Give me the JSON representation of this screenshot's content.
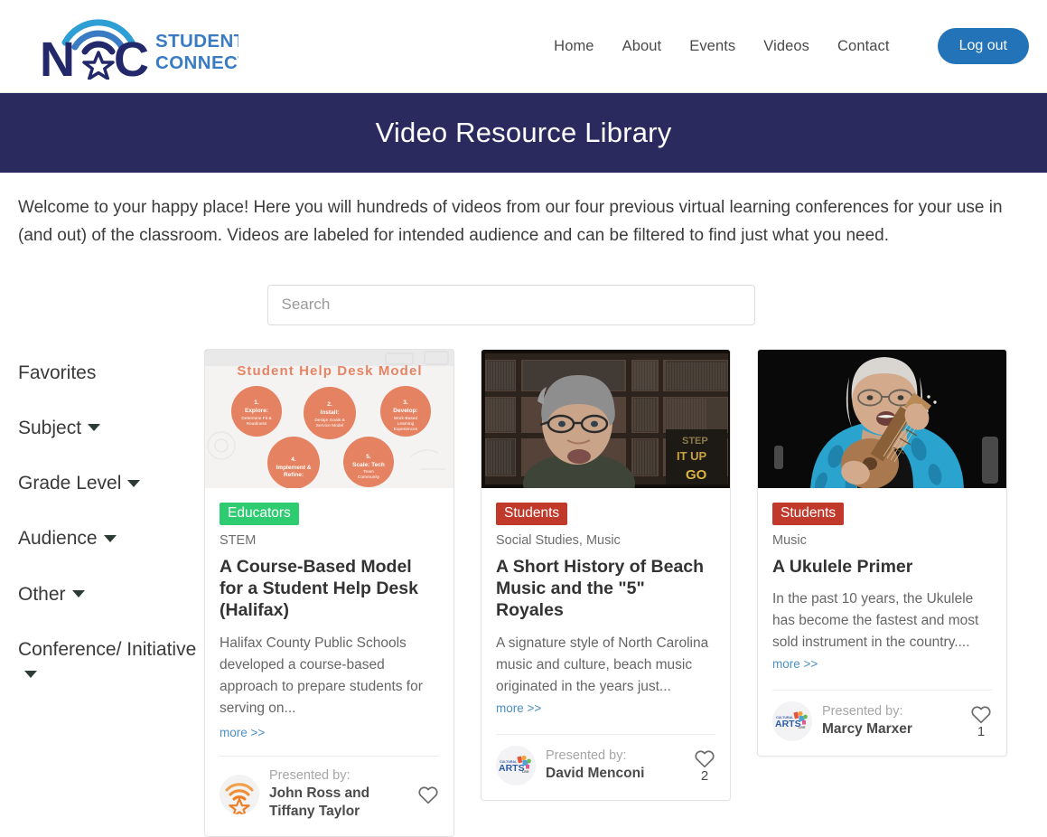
{
  "brand": {
    "logo_text_line1": "STUDENT",
    "logo_text_line2": "CONNECT",
    "logo_letter_n": "N",
    "logo_letter_c": "C",
    "colors": {
      "navy": "#2a2a5e",
      "logo_navy": "#23286b",
      "logo_blue_light": "#2e9fd4",
      "logo_blue_mid": "#3a7cc4",
      "button_blue": "#2273b8",
      "badge_green": "#2ecc71",
      "badge_red": "#c0392b",
      "link_blue": "#4a90c4"
    }
  },
  "nav": {
    "links": [
      {
        "label": "Home"
      },
      {
        "label": "About"
      },
      {
        "label": "Events"
      },
      {
        "label": "Videos"
      },
      {
        "label": "Contact"
      }
    ],
    "logout_label": "Log out"
  },
  "banner": {
    "title": "Video Resource Library"
  },
  "intro": {
    "paragraph": "Welcome to your happy place! Here you will hundreds of videos from our four previous virtual learning conferences for your use in (and out) of the classroom. Videos are labeled for intended audience and can be filtered to find just what you need."
  },
  "search": {
    "placeholder": "Search",
    "value": ""
  },
  "sidebar": {
    "filters": [
      {
        "label": "Favorites",
        "has_caret": false
      },
      {
        "label": "Subject",
        "has_caret": true
      },
      {
        "label": "Grade Level",
        "has_caret": true
      },
      {
        "label": "Audience",
        "has_caret": true
      },
      {
        "label": "Other",
        "has_caret": true
      },
      {
        "label": "Conference/ Initiative",
        "has_caret": true
      }
    ]
  },
  "cards": [
    {
      "badge": "Educators",
      "badge_type": "educators",
      "subject": "STEM",
      "title": "A Course-Based Model for a Student Help Desk (Halifax)",
      "description": "Halifax County Public Schools developed a course-based approach to prepare students for serving on...",
      "more_label": "more >>",
      "more_inline": false,
      "presented_by_label": "Presented by:",
      "presenter": "John Ross and Tiffany Taylor",
      "fav_count": "",
      "avatar_type": "nc-star-wifi",
      "thumb_type": "slide",
      "thumb_title": "Student Help Desk Model",
      "thumb_circles": [
        "1. Explore: Determine Fit & Readiness",
        "2. Install: Design Goals & Service Model",
        "3. Develop: Work-Based Learning Experiences",
        "4. Implement & Refine",
        "5. Scale: Tech Team Community"
      ]
    },
    {
      "badge": "Students",
      "badge_type": "students",
      "subject": "Social Studies, Music",
      "title": "A Short History of Beach Music and the \"5\" Royales",
      "description": "A signature style of North Carolina music and culture, beach music originated in the years just...",
      "more_label": "more >>",
      "more_inline": true,
      "presented_by_label": "Presented by:",
      "presenter": "David Menconi",
      "fav_count": "2",
      "avatar_type": "cultural-arts",
      "thumb_type": "photo-man-library",
      "thumb_title": "",
      "thumb_circles": []
    },
    {
      "badge": "Students",
      "badge_type": "students",
      "subject": "Music",
      "title": "A Ukulele Primer",
      "description": "In the past 10 years, the Ukulele has become the fastest and most sold instrument in the country....",
      "more_label": "more >>",
      "more_inline": true,
      "presented_by_label": "Presented by:",
      "presenter": "Marcy Marxer",
      "fav_count": "1",
      "avatar_type": "cultural-arts",
      "thumb_type": "photo-woman-ukulele",
      "thumb_title": "",
      "thumb_circles": []
    }
  ],
  "avatar_labels": {
    "cultural_arts_top": "CULTURAL",
    "cultural_arts_main": "ARTS",
    "cultural_arts_sub": "LIVE"
  }
}
